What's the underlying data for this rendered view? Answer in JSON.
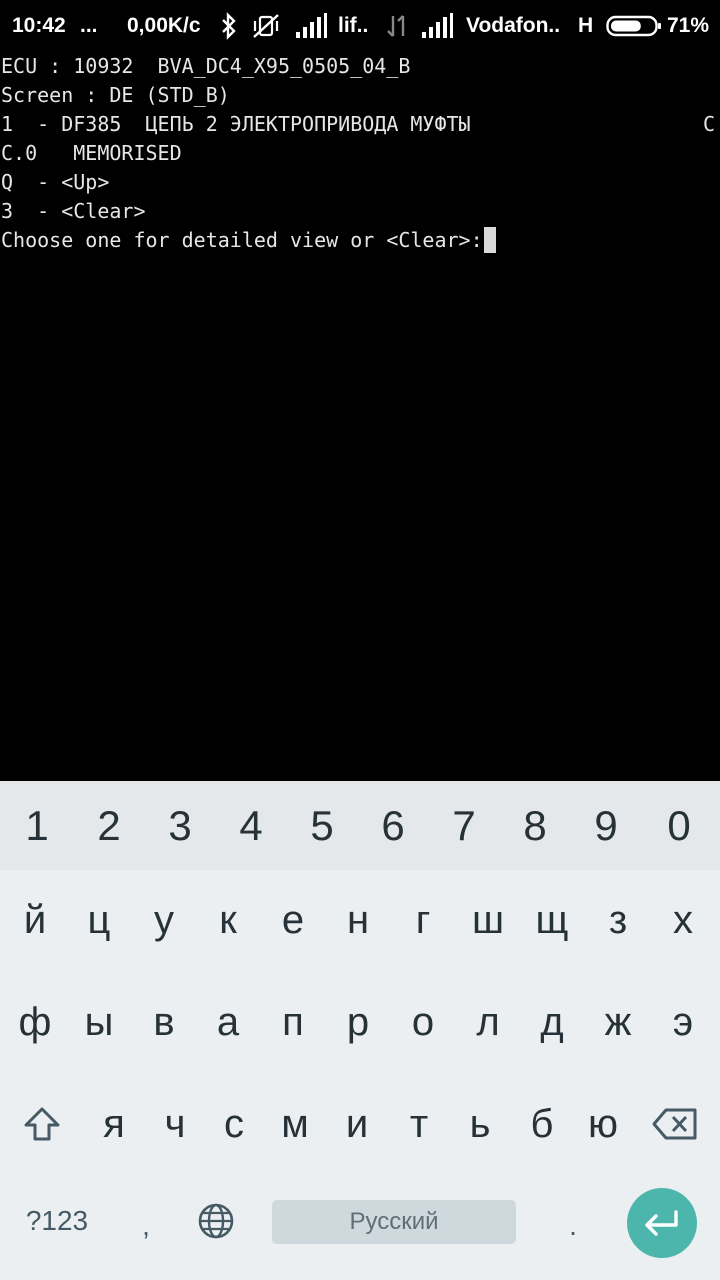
{
  "status_bar": {
    "time": "10:42",
    "dots": "...",
    "net_speed": "0,00K/c",
    "carrier1": "lif..",
    "carrier2": "Vodafon..",
    "network_type": "H",
    "battery": "71%",
    "battery_level": 0.71,
    "icons": [
      "bluetooth-icon",
      "vibrate-off-icon",
      "signal-icon",
      "data-arrows-icon",
      "signal-icon",
      "battery-icon"
    ]
  },
  "terminal": {
    "lines": [
      "ECU : 10932  BVA_DC4_X95_0505_04_B",
      "Screen : DE (STD_B)",
      "1  - DF385  ЦЕПЬ 2 ЭЛЕКТРОПРИВОДА МУФТЫ",
      "C.0   MEMORISED",
      "Q  - <Up>",
      "3  - <Clear>",
      "Choose one for detailed view or <Clear>:"
    ],
    "line3_right": "C"
  },
  "keyboard": {
    "numbers": [
      "1",
      "2",
      "3",
      "4",
      "5",
      "6",
      "7",
      "8",
      "9",
      "0"
    ],
    "row1": [
      "й",
      "ц",
      "у",
      "к",
      "е",
      "н",
      "г",
      "ш",
      "щ",
      "з",
      "х"
    ],
    "row2": [
      "ф",
      "ы",
      "в",
      "а",
      "п",
      "р",
      "о",
      "л",
      "д",
      "ж",
      "э"
    ],
    "row3": [
      "я",
      "ч",
      "с",
      "м",
      "и",
      "т",
      "ь",
      "б",
      "ю"
    ],
    "symbols_label": "?123",
    "comma": ",",
    "space_label": "Русский",
    "period": ".",
    "accent_color": "#4db6ac"
  }
}
